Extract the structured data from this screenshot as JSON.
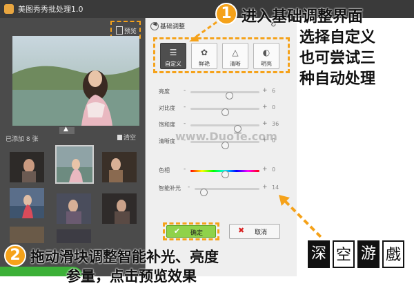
{
  "window": {
    "title": "美图秀秀批处理1.0"
  },
  "toolbar": {
    "preview_label": "预览"
  },
  "gallery": {
    "added_label": "已添加 8 张",
    "clear_label": "清空"
  },
  "panel": {
    "title": "基础调整",
    "modes": [
      {
        "label": "自定义",
        "icon": "sliders-icon",
        "active": true
      },
      {
        "label": "鲜艳",
        "icon": "flower-icon",
        "active": false
      },
      {
        "label": "清晰",
        "icon": "triangle-icon",
        "active": false
      },
      {
        "label": "明亮",
        "icon": "contrast-icon",
        "active": false
      }
    ],
    "sliders": [
      {
        "label": "亮度",
        "value": "6",
        "position": 0.56
      },
      {
        "label": "对比度",
        "value": "0",
        "position": 0.5
      },
      {
        "label": "饱和度",
        "value": "36",
        "position": 0.68
      },
      {
        "label": "清晰度",
        "value": "0",
        "position": 0.5
      },
      {
        "label": "色相",
        "value": "0",
        "position": 0.5,
        "rainbow": true
      },
      {
        "label": "智能补光",
        "value": "14",
        "position": 0.14
      }
    ],
    "ok_label": "确定",
    "cancel_label": "取消"
  },
  "watermark": "www.DuoTe.com",
  "annotations": {
    "step1_number": "1",
    "step1_lines": [
      "进入基础调整界面",
      "选择自定义",
      "也可尝试三",
      "种自动处理"
    ],
    "step2_number": "2",
    "step2_line1": "拖动滑块调整智能补光、亮度",
    "step2_line2": "参量，点击预览效果"
  },
  "logo": {
    "chars": [
      "深",
      "空",
      "游",
      "戲"
    ]
  },
  "colors": {
    "accent": "#f5a21a",
    "ok_green": "#8fd24a",
    "dark_bg": "#4b4b4b"
  }
}
